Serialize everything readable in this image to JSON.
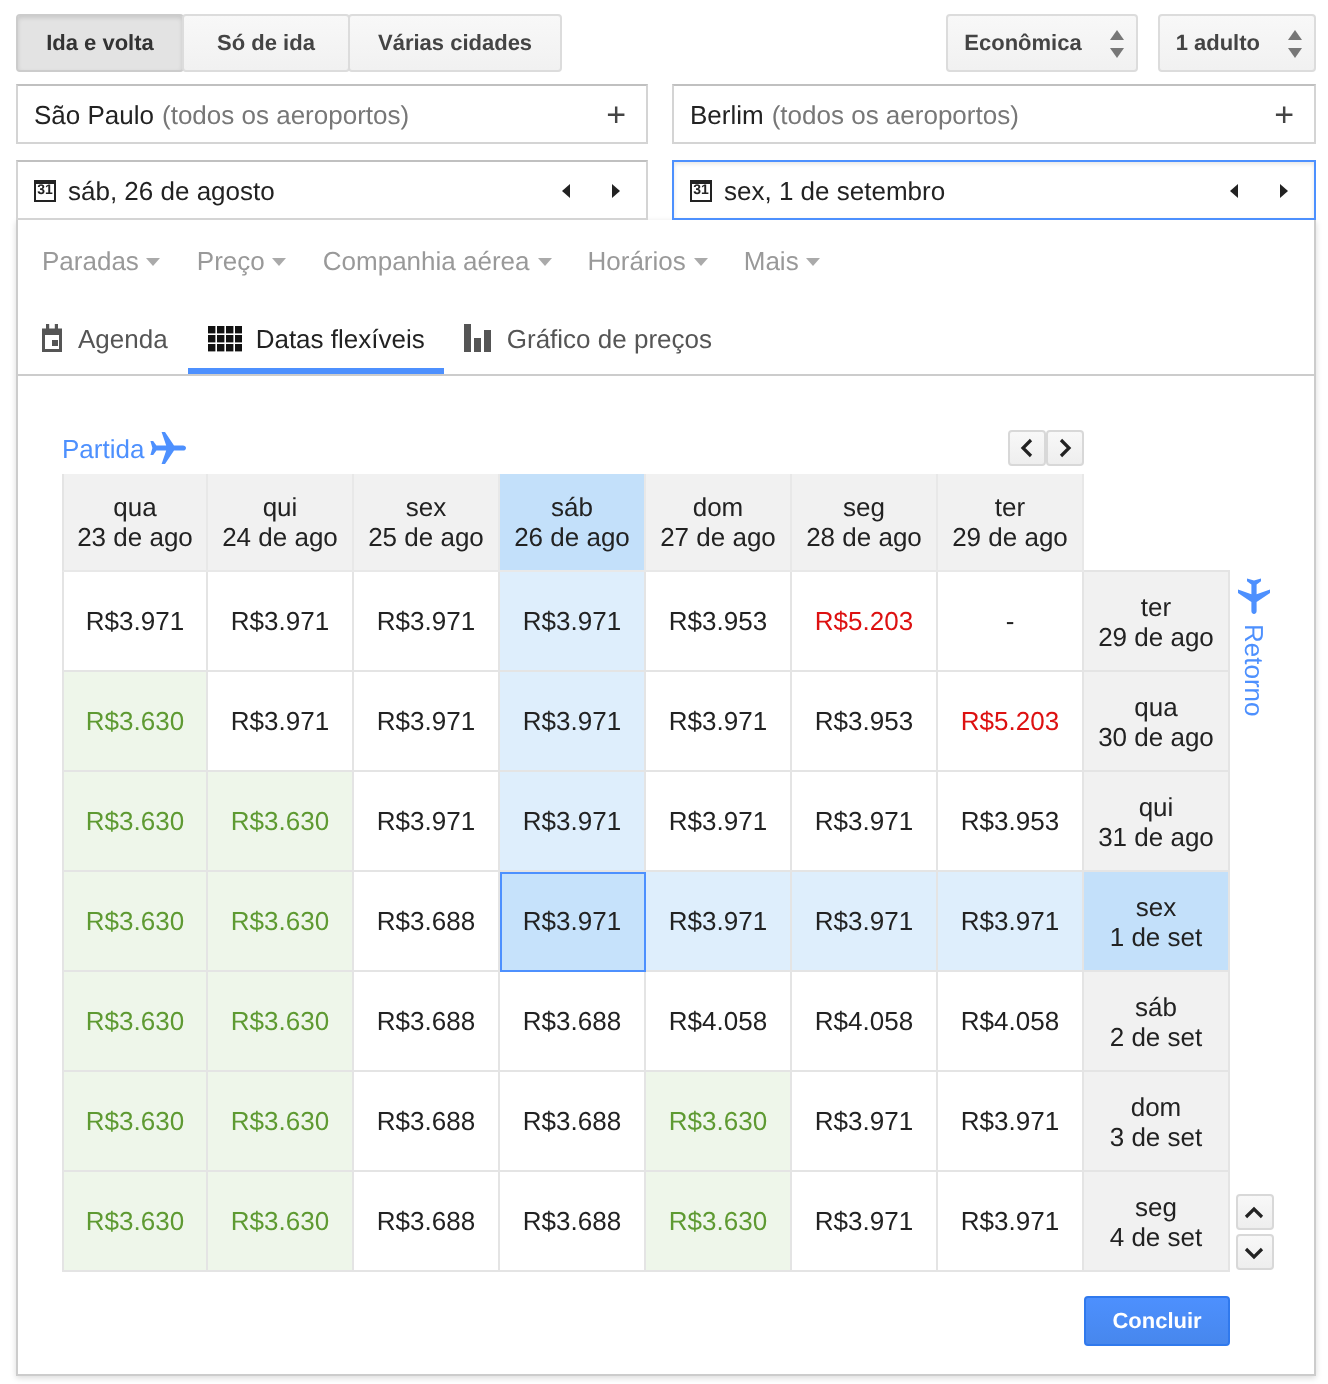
{
  "trip_types": [
    {
      "label": "Ida e volta",
      "selected": true
    },
    {
      "label": "Só de ida",
      "selected": false
    },
    {
      "label": "Várias cidades",
      "selected": false
    }
  ],
  "selectors": [
    {
      "label": "Econômica"
    },
    {
      "label": "1 adulto"
    }
  ],
  "places": [
    {
      "city": "São Paulo",
      "hint": "(todos os aeroportos)",
      "add": "+"
    },
    {
      "city": "Berlim",
      "hint": "(todos os aeroportos)",
      "add": "+"
    }
  ],
  "dates": [
    {
      "icon_text": "31",
      "value": "sáb, 26 de agosto",
      "focused": false
    },
    {
      "icon_text": "31",
      "value": "sex, 1 de setembro",
      "focused": true
    }
  ],
  "filters": [
    "Paradas",
    "Preço",
    "Companhia aérea",
    "Horários",
    "Mais"
  ],
  "view_tabs": [
    {
      "label": "Agenda",
      "kind": "calendar",
      "selected": false
    },
    {
      "label": "Datas flexíveis",
      "kind": "grid",
      "selected": true
    },
    {
      "label": "Gráfico de preços",
      "kind": "bars",
      "selected": false
    }
  ],
  "grid": {
    "departure_label": "Partida",
    "return_label": "Retorno",
    "columns": [
      {
        "weekday": "qua",
        "date": "23 de ago",
        "selected": false
      },
      {
        "weekday": "qui",
        "date": "24 de ago",
        "selected": false
      },
      {
        "weekday": "sex",
        "date": "25 de ago",
        "selected": false
      },
      {
        "weekday": "sáb",
        "date": "26 de ago",
        "selected": true
      },
      {
        "weekday": "dom",
        "date": "27 de ago",
        "selected": false
      },
      {
        "weekday": "seg",
        "date": "28 de ago",
        "selected": false
      },
      {
        "weekday": "ter",
        "date": "29 de ago",
        "selected": false
      }
    ],
    "rows": [
      {
        "weekday": "ter",
        "date": "29 de ago",
        "selected": false,
        "cells": [
          {
            "price": "R$3.971",
            "kind": "normal"
          },
          {
            "price": "R$3.971",
            "kind": "normal"
          },
          {
            "price": "R$3.971",
            "kind": "normal"
          },
          {
            "price": "R$3.971",
            "kind": "normal"
          },
          {
            "price": "R$3.953",
            "kind": "normal"
          },
          {
            "price": "R$5.203",
            "kind": "high"
          },
          {
            "price": "-",
            "kind": "normal"
          }
        ]
      },
      {
        "weekday": "qua",
        "date": "30 de ago",
        "selected": false,
        "cells": [
          {
            "price": "R$3.630",
            "kind": "low"
          },
          {
            "price": "R$3.971",
            "kind": "normal"
          },
          {
            "price": "R$3.971",
            "kind": "normal"
          },
          {
            "price": "R$3.971",
            "kind": "normal"
          },
          {
            "price": "R$3.971",
            "kind": "normal"
          },
          {
            "price": "R$3.953",
            "kind": "normal"
          },
          {
            "price": "R$5.203",
            "kind": "high"
          }
        ]
      },
      {
        "weekday": "qui",
        "date": "31 de ago",
        "selected": false,
        "cells": [
          {
            "price": "R$3.630",
            "kind": "low"
          },
          {
            "price": "R$3.630",
            "kind": "low"
          },
          {
            "price": "R$3.971",
            "kind": "normal"
          },
          {
            "price": "R$3.971",
            "kind": "normal"
          },
          {
            "price": "R$3.971",
            "kind": "normal"
          },
          {
            "price": "R$3.971",
            "kind": "normal"
          },
          {
            "price": "R$3.953",
            "kind": "normal"
          }
        ]
      },
      {
        "weekday": "sex",
        "date": "1 de set",
        "selected": true,
        "cells": [
          {
            "price": "R$3.630",
            "kind": "low"
          },
          {
            "price": "R$3.630",
            "kind": "low"
          },
          {
            "price": "R$3.688",
            "kind": "normal"
          },
          {
            "price": "R$3.971",
            "kind": "normal"
          },
          {
            "price": "R$3.971",
            "kind": "normal"
          },
          {
            "price": "R$3.971",
            "kind": "normal"
          },
          {
            "price": "R$3.971",
            "kind": "normal"
          }
        ]
      },
      {
        "weekday": "sáb",
        "date": "2 de set",
        "selected": false,
        "cells": [
          {
            "price": "R$3.630",
            "kind": "low"
          },
          {
            "price": "R$3.630",
            "kind": "low"
          },
          {
            "price": "R$3.688",
            "kind": "normal"
          },
          {
            "price": "R$3.688",
            "kind": "normal"
          },
          {
            "price": "R$4.058",
            "kind": "normal"
          },
          {
            "price": "R$4.058",
            "kind": "normal"
          },
          {
            "price": "R$4.058",
            "kind": "normal"
          }
        ]
      },
      {
        "weekday": "dom",
        "date": "3 de set",
        "selected": false,
        "cells": [
          {
            "price": "R$3.630",
            "kind": "low"
          },
          {
            "price": "R$3.630",
            "kind": "low"
          },
          {
            "price": "R$3.688",
            "kind": "normal"
          },
          {
            "price": "R$3.688",
            "kind": "normal"
          },
          {
            "price": "R$3.630",
            "kind": "low"
          },
          {
            "price": "R$3.971",
            "kind": "normal"
          },
          {
            "price": "R$3.971",
            "kind": "normal"
          }
        ]
      },
      {
        "weekday": "seg",
        "date": "4 de set",
        "selected": false,
        "cells": [
          {
            "price": "R$3.630",
            "kind": "low"
          },
          {
            "price": "R$3.630",
            "kind": "low"
          },
          {
            "price": "R$3.688",
            "kind": "normal"
          },
          {
            "price": "R$3.688",
            "kind": "normal"
          },
          {
            "price": "R$3.630",
            "kind": "low"
          },
          {
            "price": "R$3.971",
            "kind": "normal"
          },
          {
            "price": "R$3.971",
            "kind": "normal"
          }
        ]
      }
    ]
  },
  "done_button": "Concluir"
}
